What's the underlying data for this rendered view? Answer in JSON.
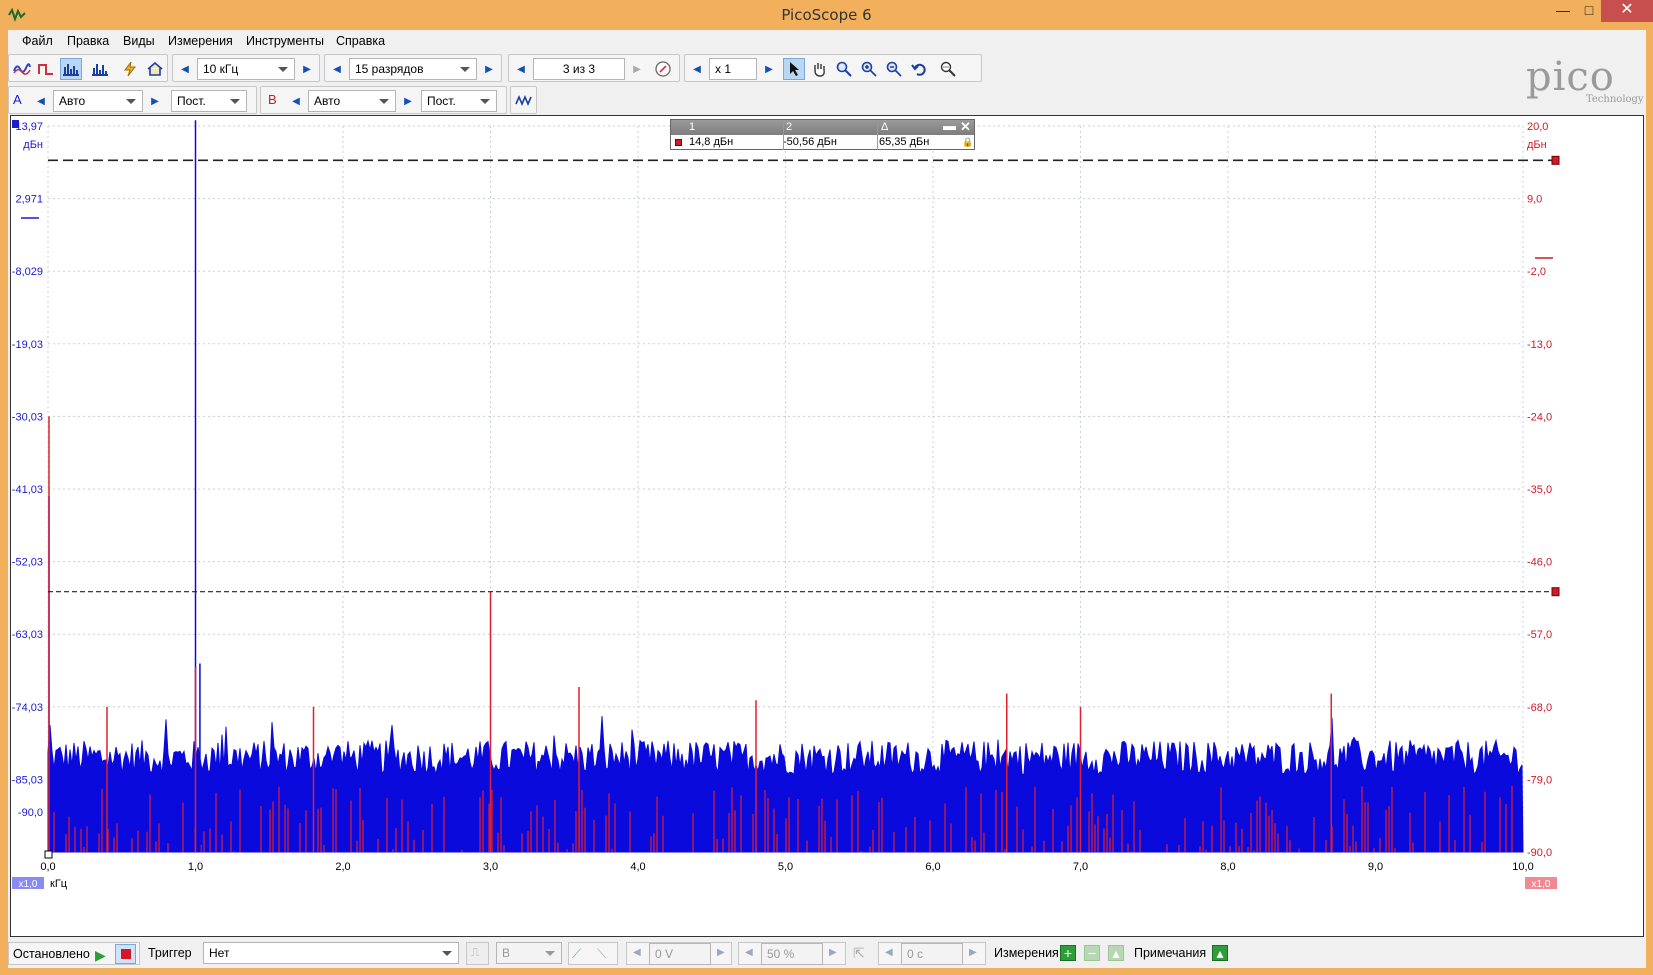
{
  "window": {
    "title": "PicoScope 6",
    "minimize": "—",
    "maximize": "□",
    "close": "✕"
  },
  "menu": [
    "Файл",
    "Правка",
    "Виды",
    "Измерения",
    "Инструменты",
    "Справка"
  ],
  "toolbar": {
    "frequency": "10 кГц",
    "resolution": "15 разрядов",
    "buffer": "3 из 3",
    "zoom": "x 1"
  },
  "channels": {
    "a": {
      "label": "A",
      "range": "Авто",
      "coupling": "Пост.",
      "color": "#1a1ad0"
    },
    "b": {
      "label": "B",
      "range": "Авто",
      "coupling": "Пост.",
      "color": "#d01a2a"
    }
  },
  "logo": {
    "word": "pico",
    "sub": "Technology"
  },
  "ruler_table": {
    "headers": [
      "1",
      "2",
      "Δ"
    ],
    "values": [
      "14,8 дБн",
      "-50,56 дБн",
      "65,35 дБн"
    ]
  },
  "chart_data": {
    "type": "line",
    "xlabel": "кГц",
    "x_ticks": [
      "0,0",
      "1,0",
      "2,0",
      "3,0",
      "4,0",
      "5,0",
      "6,0",
      "7,0",
      "8,0",
      "9,0",
      "10,0"
    ],
    "xlim": [
      0,
      10
    ],
    "left_axis": {
      "unit": "дБн",
      "ticks": [
        "13,97",
        "2,971",
        "-8,029",
        "-19,03",
        "-30,03",
        "-41,03",
        "-52,03",
        "-63,03",
        "-74,03",
        "-85,03",
        "-90,0"
      ],
      "ylim": [
        -90,
        13.97
      ],
      "scale": "x1,0"
    },
    "right_axis": {
      "unit": "дБн",
      "ticks": [
        "20,0",
        "9,0",
        "-2,0",
        "-13,0",
        "-24,0",
        "-35,0",
        "-46,0",
        "-57,0",
        "-68,0",
        "-79,0",
        "-90,0"
      ],
      "ylim": [
        -90,
        20
      ],
      "scale": "x1,0"
    },
    "grid": true,
    "rulers_db": [
      14.8,
      -50.56
    ],
    "series": [
      {
        "name": "A",
        "color": "#0a0adc",
        "noise_floor": -85,
        "noise_top": -74,
        "peaks": [
          [
            0.0,
            -39
          ],
          [
            1.0,
            14.8
          ],
          [
            1.03,
            -63
          ]
        ]
      },
      {
        "name": "B",
        "color": "#e0202e",
        "noise_floor": -90,
        "noise_top": -80,
        "peaks": [
          [
            0.0,
            -24
          ],
          [
            1.0,
            -62
          ],
          [
            3.0,
            -50.5
          ],
          [
            0.4,
            -68
          ],
          [
            1.8,
            -68
          ],
          [
            3.6,
            -65
          ],
          [
            4.8,
            -67
          ],
          [
            7.0,
            -68
          ],
          [
            6.5,
            -66
          ],
          [
            8.7,
            -66
          ]
        ]
      }
    ]
  },
  "status": {
    "state": "Остановлено",
    "trigger_label": "Триггер",
    "trigger_mode": "Нет",
    "trigger_channel": "B",
    "trigger_level": "0 V",
    "pretrigger": "50 %",
    "delay": "0 с",
    "measurements": "Измерения",
    "notes": "Примечания"
  }
}
